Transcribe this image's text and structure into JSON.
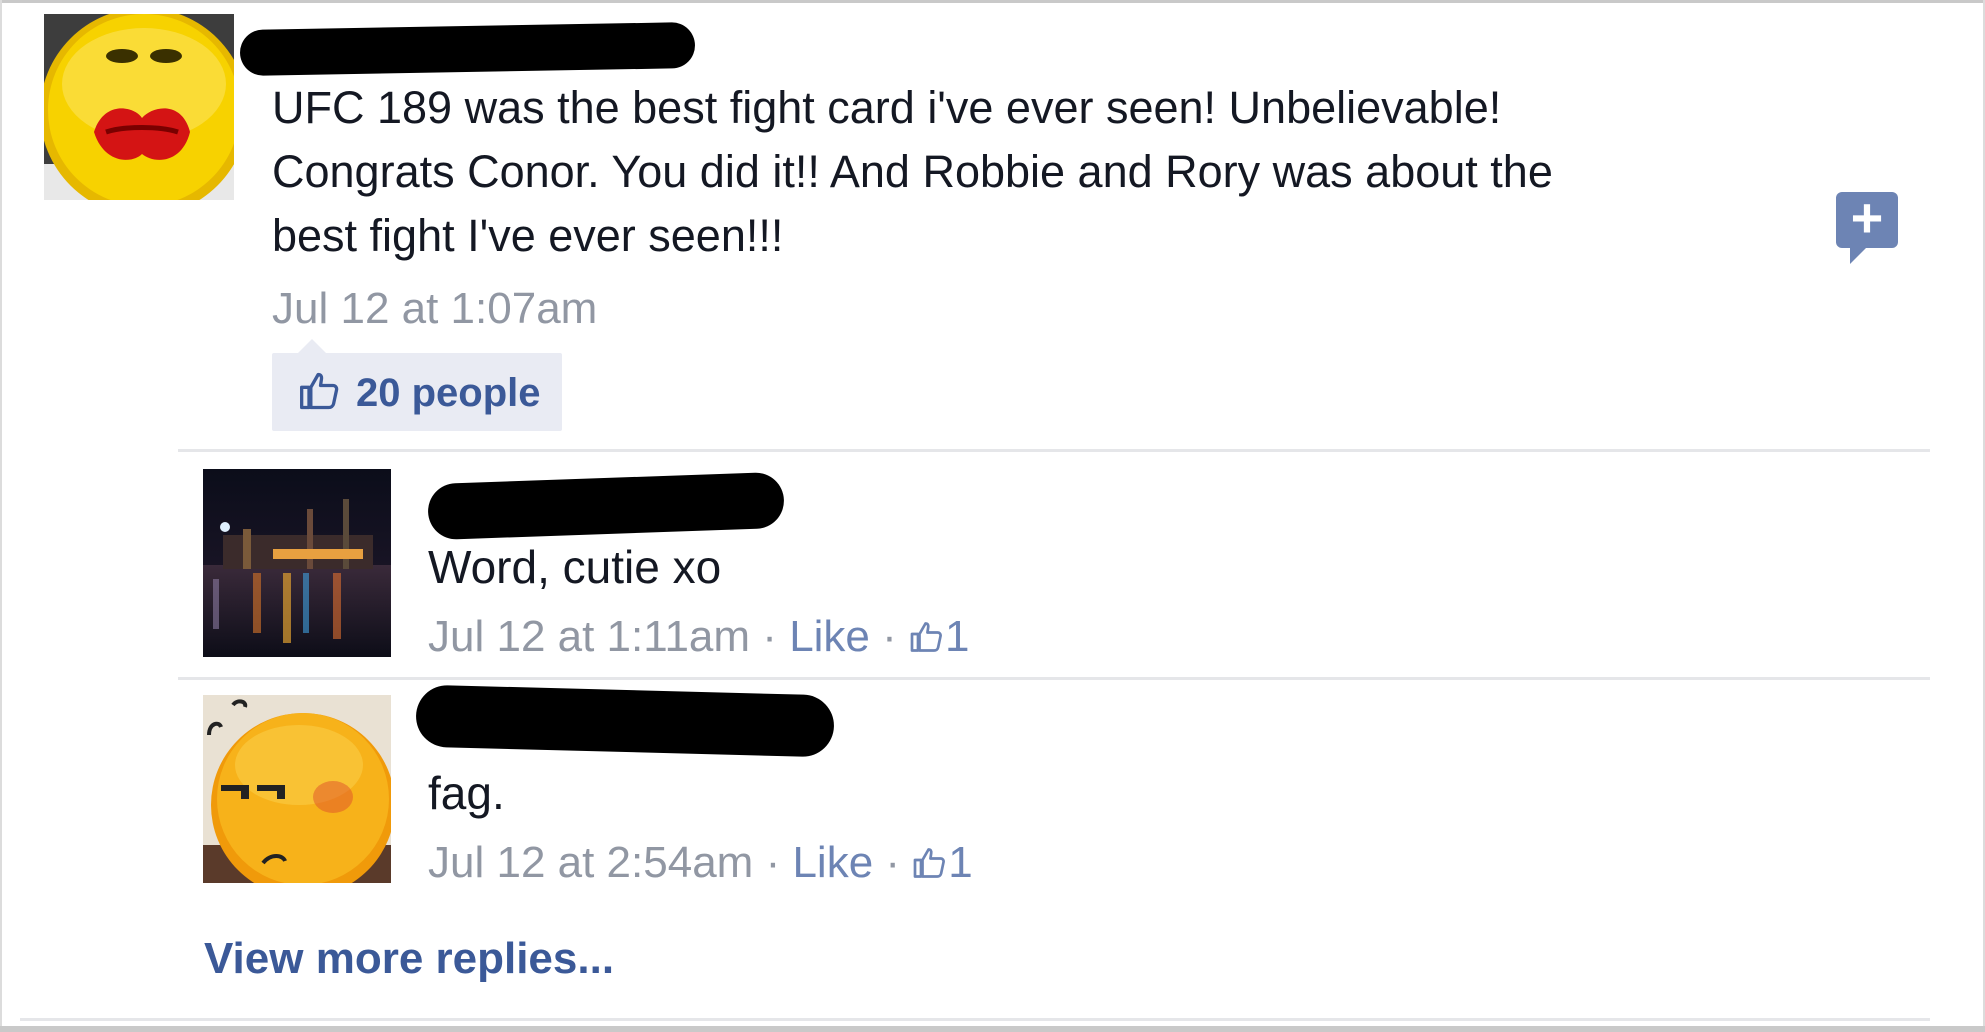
{
  "post": {
    "text_line1": "UFC 189 was the best fight card i've ever seen! Unbelievable!",
    "text_line2": "Congrats Conor. You did it!! And Robbie and Rory was about the",
    "text_line3": "best fight I've ever seen!!!",
    "timestamp": "Jul 12 at 1:07am",
    "likes_label": "20 people",
    "add_icon": "plus-icon"
  },
  "replies": [
    {
      "text": "Word, cutie xo",
      "timestamp": "Jul 12 at 1:11am",
      "like_label": "Like",
      "like_count": "1"
    },
    {
      "text": "fag.",
      "timestamp": "Jul 12 at 2:54am",
      "like_label": "Like",
      "like_count": "1"
    }
  ],
  "view_more_label": "View more replies...",
  "separator": "·",
  "colors": {
    "link": "#6d84b4",
    "brand": "#3b5998",
    "meta": "#9197a3",
    "like_box_bg": "#e9ebf3"
  }
}
